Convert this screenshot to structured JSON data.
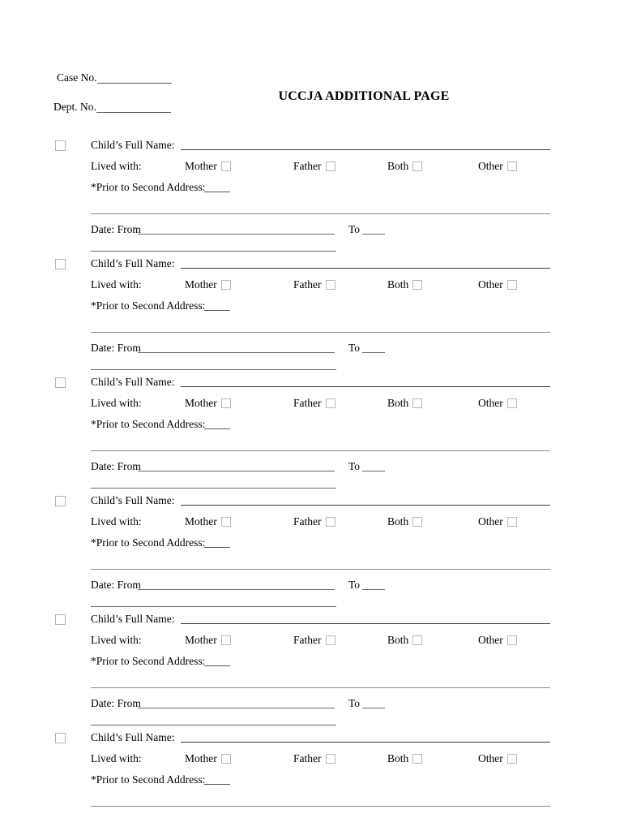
{
  "document": {
    "title": "UCCJA ADDITIONAL PAGE"
  },
  "header": {
    "case_no_label": "Case No.",
    "case_no_value": "",
    "dept_no_label": "Dept. No.",
    "dept_no_value": ""
  },
  "labels": {
    "child_name_label": "Child’s Full Name:",
    "lived_with_label": "Lived with:",
    "prior_address_label": "*Prior to Second Address:",
    "date_label": "Date:  From",
    "to_label": "To"
  },
  "options": [
    {
      "label": "Mother",
      "checked": false
    },
    {
      "label": "Father",
      "checked": false
    },
    {
      "label": "Both",
      "checked": false
    },
    {
      "label": "Other",
      "checked": false
    }
  ],
  "blocks": [
    {
      "index": 1,
      "selected": false,
      "child_name_value": "",
      "prior_address_value": "",
      "date_from_value": "",
      "date_to_value": "",
      "has_date_row": true
    },
    {
      "index": 2,
      "selected": false,
      "child_name_value": "",
      "prior_address_value": "",
      "date_from_value": "",
      "date_to_value": "",
      "has_date_row": true
    },
    {
      "index": 3,
      "selected": false,
      "child_name_value": "",
      "prior_address_value": "",
      "date_from_value": "",
      "date_to_value": "",
      "has_date_row": true
    },
    {
      "index": 4,
      "selected": false,
      "child_name_value": "",
      "prior_address_value": "",
      "date_from_value": "",
      "date_to_value": "",
      "has_date_row": true
    },
    {
      "index": 5,
      "selected": false,
      "child_name_value": "",
      "prior_address_value": "",
      "date_from_value": "",
      "date_to_value": "",
      "has_date_row": true
    },
    {
      "index": 6,
      "selected": false,
      "child_name_value": "",
      "prior_address_value": "",
      "date_from_value": "",
      "date_to_value": "",
      "has_date_row": false
    }
  ],
  "colors": {
    "text": "#000000",
    "rule_dark": "#3a3a3a",
    "rule_mid": "#6a6a6a",
    "rule_light": "#8a8a8a",
    "checkbox_border": "#b8b8b8",
    "background": "#ffffff"
  }
}
